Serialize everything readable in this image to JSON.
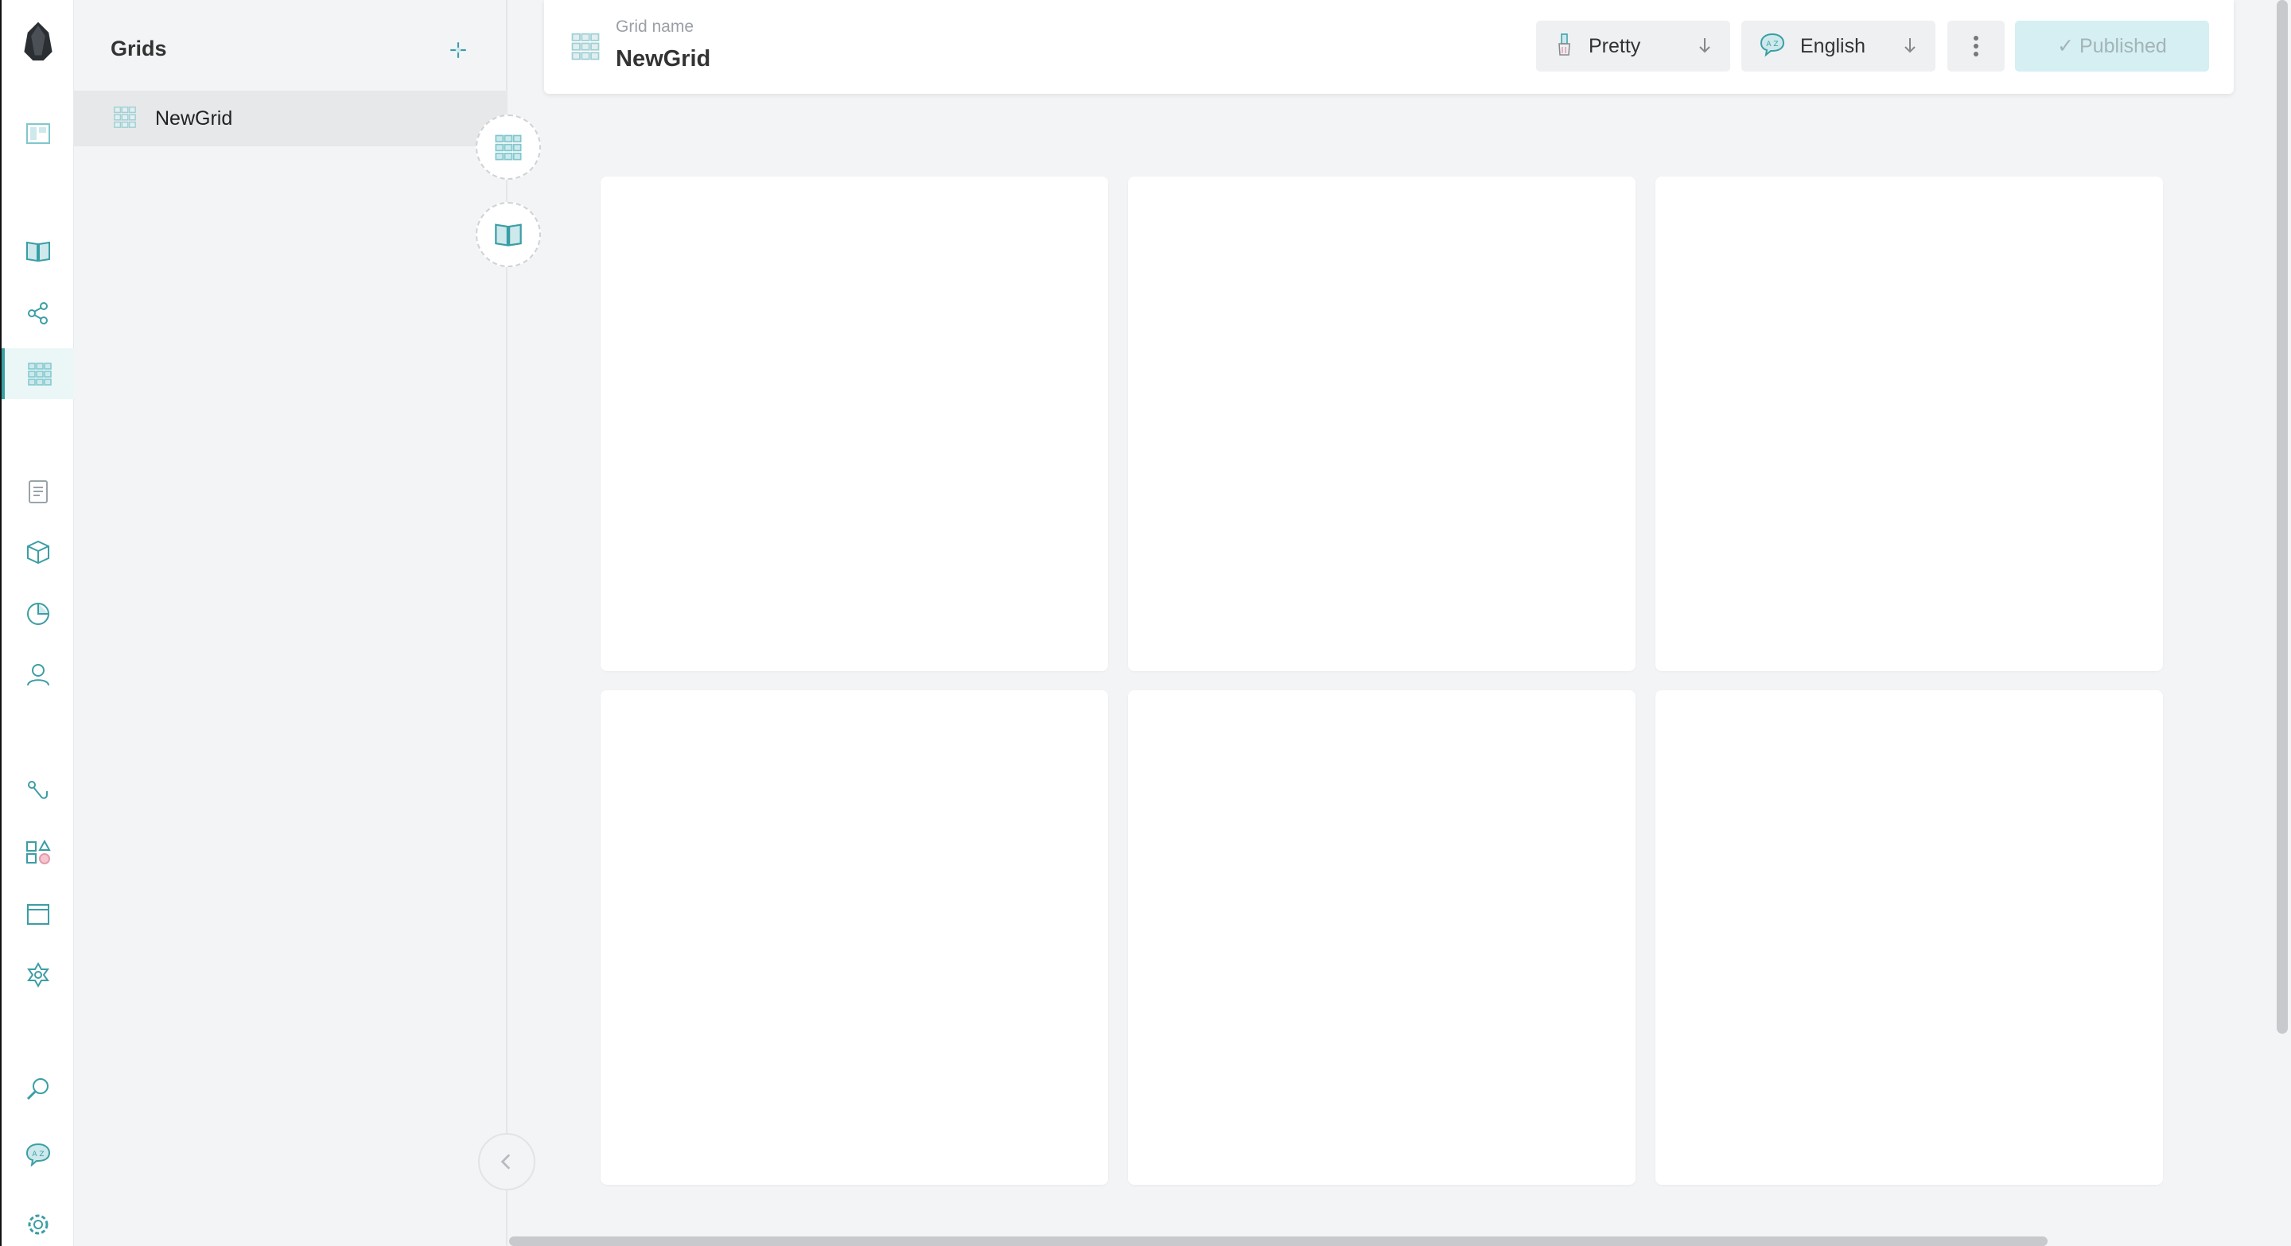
{
  "sidebar": {
    "title": "Grids",
    "items": [
      {
        "label": "NewGrid"
      }
    ]
  },
  "header": {
    "grid_name_label": "Grid name",
    "grid_name_value": "NewGrid",
    "theme_dropdown": "Pretty",
    "language_dropdown": "English",
    "status_button": "✓ Published"
  },
  "colors": {
    "accent": "#3b9ea5",
    "accent_light": "#7fc7cd",
    "publish_bg": "#d5eff2"
  },
  "rail": {
    "icons": [
      "logo-icon",
      "dashboard-icon",
      "book-icon",
      "share-icon",
      "grid-icon",
      "clipboard-icon",
      "box-icon",
      "pie-chart-icon",
      "user-icon",
      "hook-icon",
      "shapes-icon",
      "window-icon",
      "settings-star-icon",
      "search-icon",
      "translate-icon",
      "gear-icon"
    ]
  },
  "grid": {
    "cells": [
      "",
      "",
      "",
      "",
      "",
      ""
    ]
  }
}
